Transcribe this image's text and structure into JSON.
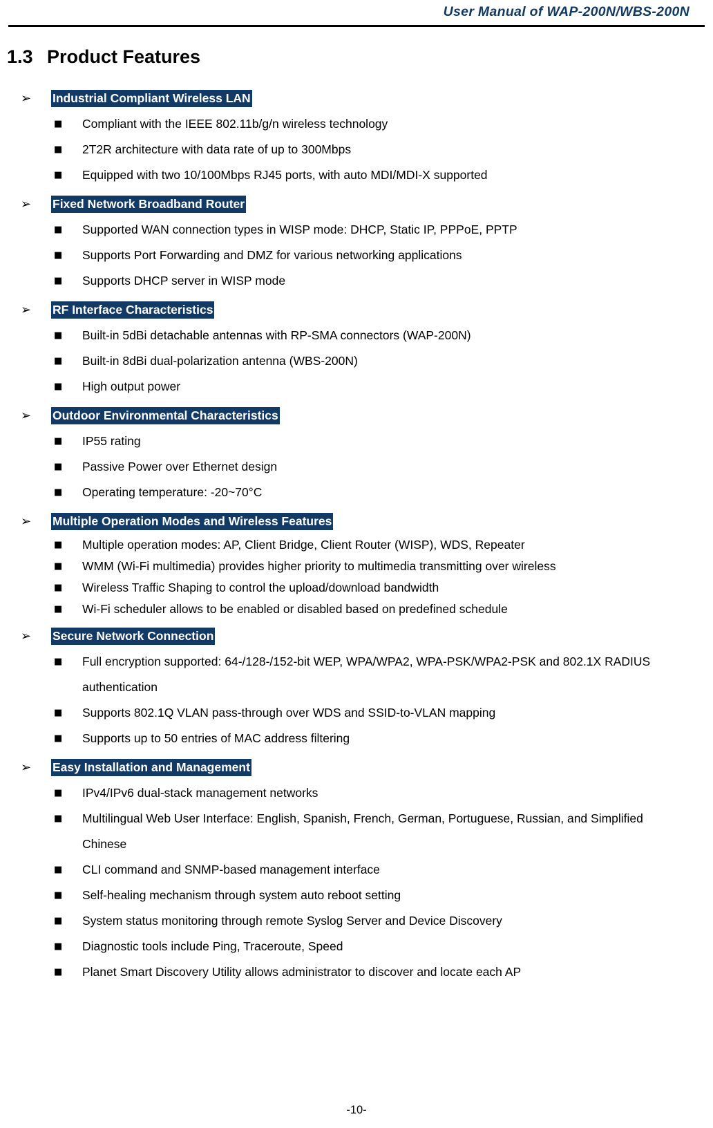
{
  "header": {
    "title": "User  Manual  of  WAP-200N/WBS-200N"
  },
  "section": {
    "number": "1.3",
    "title": "Product Features"
  },
  "colors": {
    "highlight_background": "#123A66",
    "highlight_text": "#FFFFFF",
    "header_text": "#123A66",
    "body_text": "#000000"
  },
  "icons": {
    "arrow_bullet": "➢",
    "square_bullet": "■"
  },
  "groups": [
    {
      "title": "Industrial Compliant Wireless LAN",
      "bullets": [
        "Compliant with the IEEE 802.11b/g/n wireless technology",
        "2T2R architecture with data rate of up to 300Mbps",
        "Equipped with two 10/100Mbps RJ45 ports, with auto MDI/MDI-X supported"
      ]
    },
    {
      "title": "Fixed Network Broadband Router",
      "bullets": [
        "Supported WAN connection types in WISP mode: DHCP, Static IP, PPPoE, PPTP",
        "Supports Port Forwarding and DMZ for various networking applications",
        "Supports DHCP server in WISP mode"
      ]
    },
    {
      "title": "RF Interface Characteristics",
      "bullets": [
        "Built-in 5dBi detachable antennas with RP-SMA connectors (WAP-200N)",
        "Built-in 8dBi dual-polarization antenna (WBS-200N)",
        "High output power"
      ]
    },
    {
      "title": "Outdoor Environmental Characteristics",
      "bullets": [
        "IP55 rating",
        "Passive Power over Ethernet design",
        "Operating temperature: -20~70°C"
      ]
    },
    {
      "title": "Multiple Operation Modes and Wireless Features",
      "tight": true,
      "bullets": [
        "Multiple operation modes: AP, Client Bridge, Client Router (WISP), WDS, Repeater",
        "WMM (Wi-Fi multimedia) provides higher priority to multimedia transmitting over wireless",
        "Wireless Traffic Shaping to control the upload/download bandwidth",
        "Wi-Fi scheduler allows to be enabled or disabled based on predefined schedule"
      ]
    },
    {
      "title": "Secure Network Connection",
      "bullets": [
        "Full encryption supported: 64-/128-/152-bit WEP, WPA/WPA2, WPA-PSK/WPA2-PSK and 802.1X RADIUS authentication",
        "Supports 802.1Q VLAN pass-through over WDS and SSID-to-VLAN mapping",
        "Supports up to 50 entries of MAC address filtering"
      ]
    },
    {
      "title": "Easy Installation and Management",
      "bullets": [
        "IPv4/IPv6 dual-stack management networks",
        "Multilingual Web User Interface: English, Spanish, French, German, Portuguese, Russian, and Simplified Chinese",
        "CLI command and SNMP-based management interface",
        "Self-healing mechanism through system auto reboot setting",
        "System status monitoring through remote Syslog Server and Device Discovery",
        "Diagnostic tools include Ping, Traceroute, Speed",
        "Planet Smart Discovery Utility allows administrator to discover and locate each AP"
      ]
    }
  ],
  "footer": {
    "page_number": "-10-"
  }
}
